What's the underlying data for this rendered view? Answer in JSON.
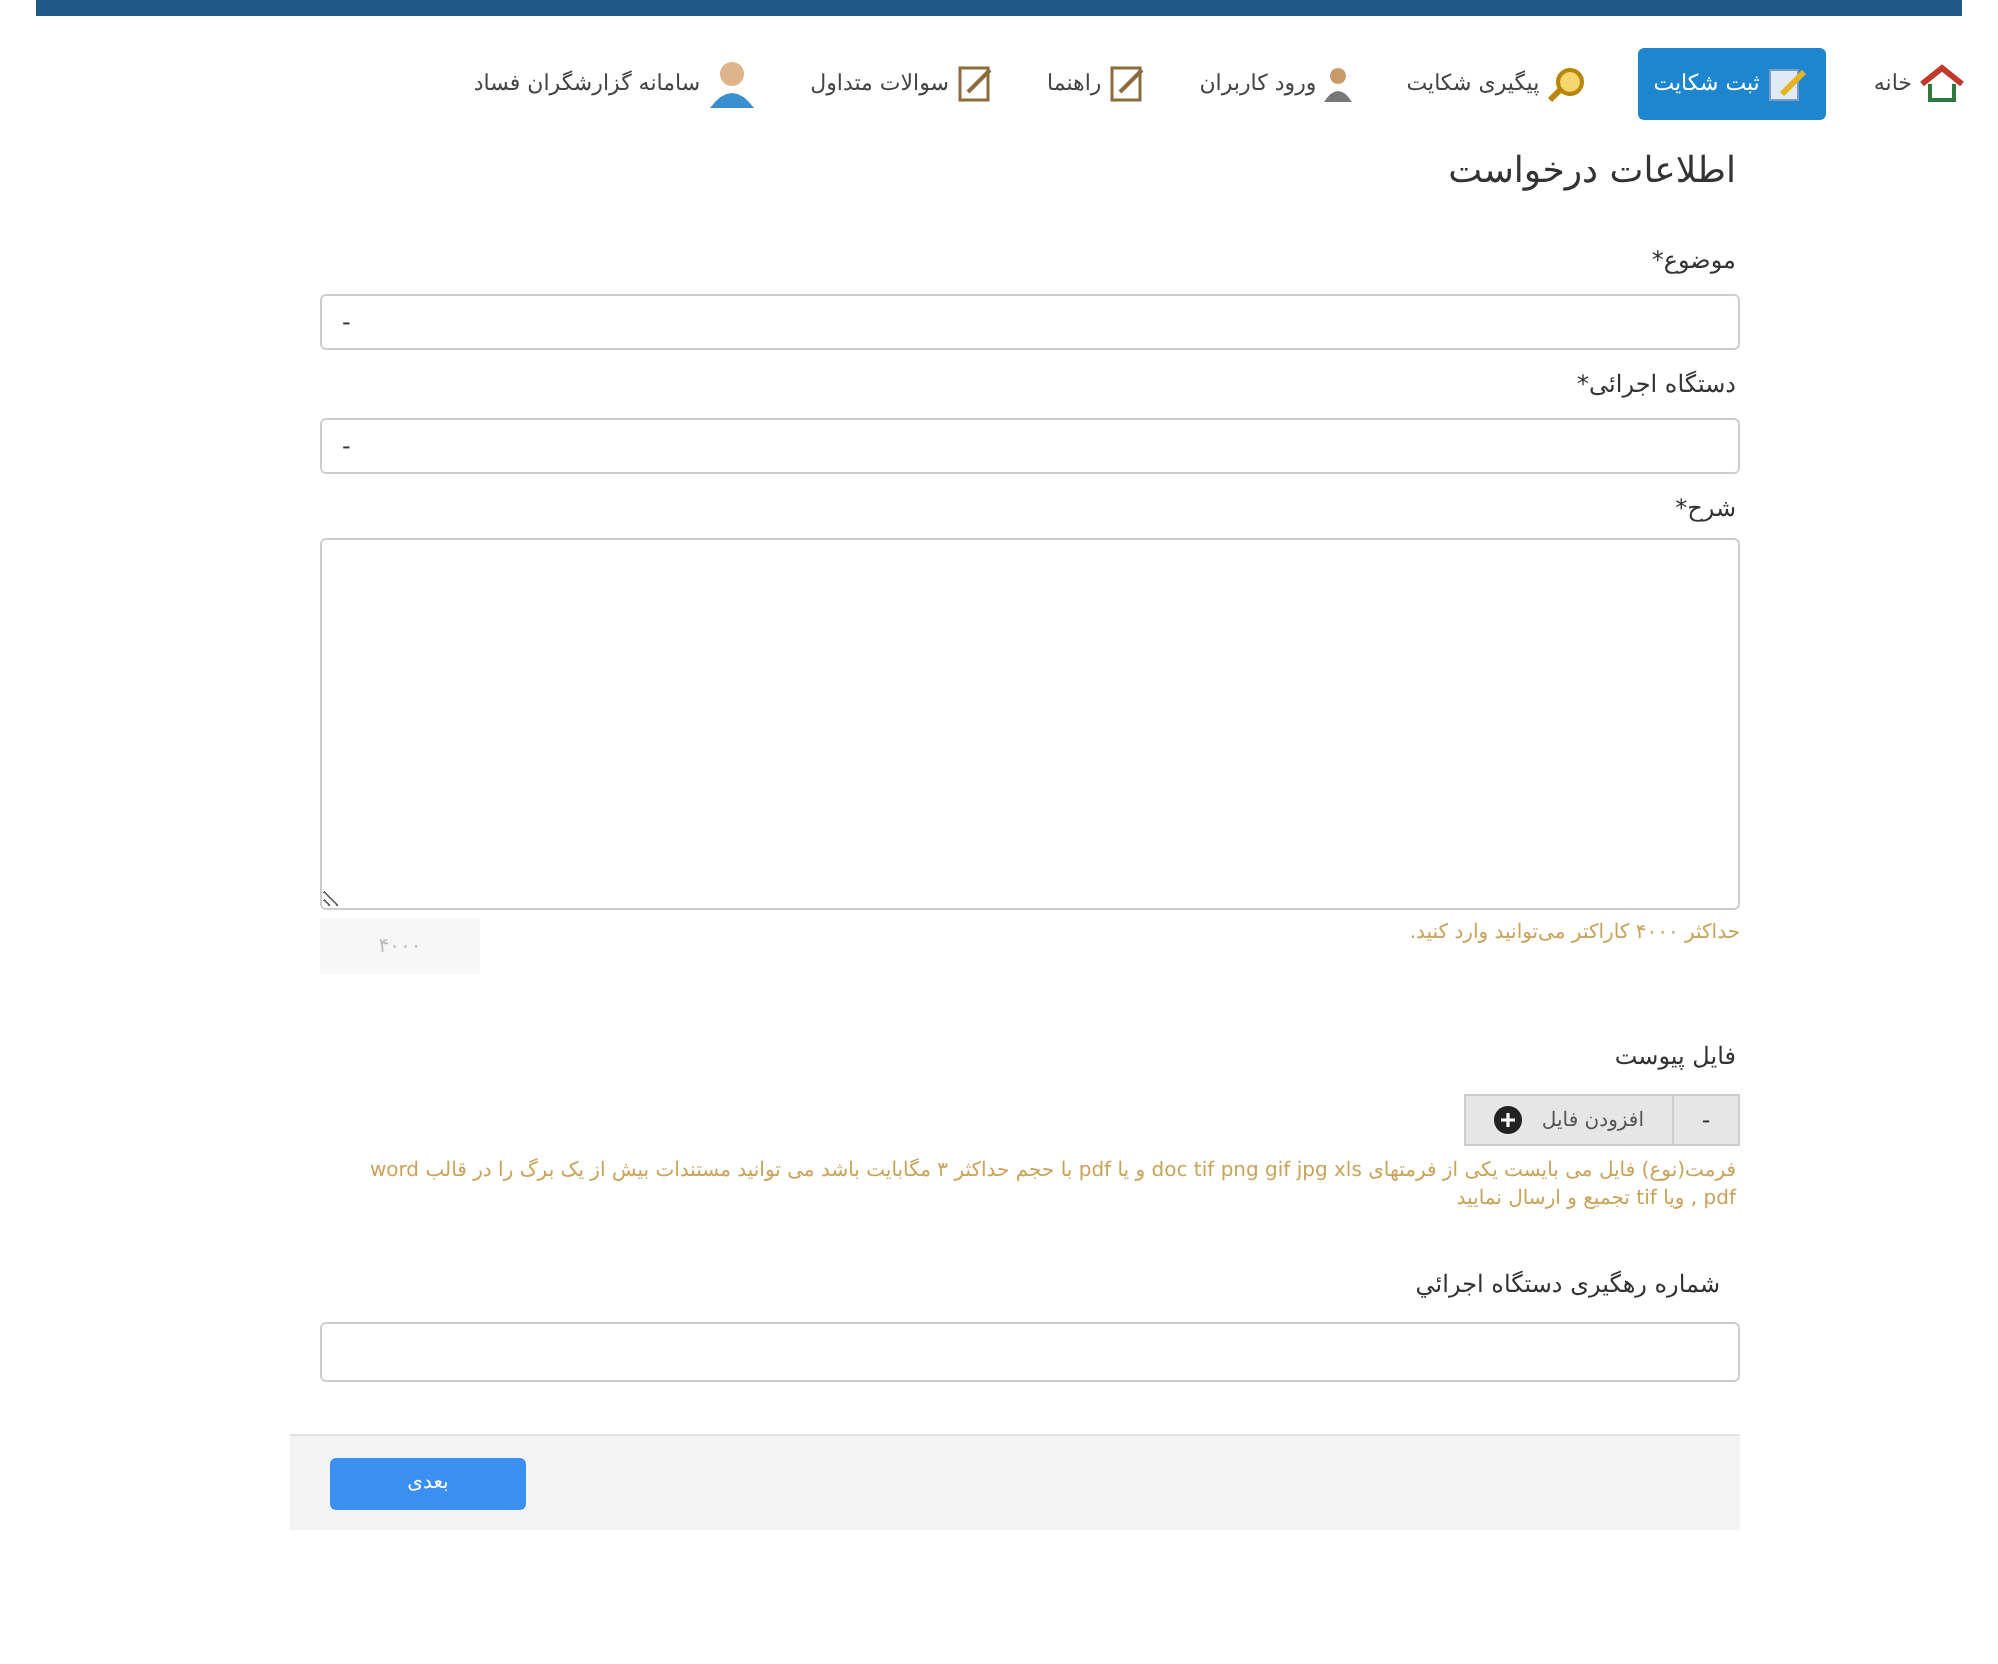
{
  "nav": [
    {
      "label": "خانه",
      "selected": false
    },
    {
      "label": "ثبت شکایت",
      "selected": true
    },
    {
      "label": "پیگیری شکایت",
      "selected": false
    },
    {
      "label": "ورود کاربران",
      "selected": false
    },
    {
      "label": "راهنما",
      "selected": false
    },
    {
      "label": "سوالات متداول",
      "selected": false
    },
    {
      "label": "سامانه گزارشگران فساد",
      "selected": false
    }
  ],
  "form": {
    "title": "اطلاعات درخواست",
    "subject": {
      "label": "موضوع",
      "required_mark": "*",
      "value": "-"
    },
    "agency": {
      "label": "دستگاه اجرائی",
      "required_mark": "*",
      "value": "-"
    },
    "description": {
      "label": "شرح",
      "required_mark": "*",
      "hint": "حداکثر ۴۰۰۰ کاراکتر می‌توانید وارد کنید.",
      "counter": "۴۰۰۰"
    },
    "attachment": {
      "label": "فایل پیوست",
      "remove": "-",
      "add": "افزودن فایل",
      "note": "فرمت(نوع) فایل می بایست یکی از فرمتهای doc tif png gif jpg xls و یا pdf با حجم حداکثر ۳ مگابایت باشد می توانید مستندات بیش از یک برگ را در قالب word , pdf ویا tif تجمیع و ارسال نمایید"
    },
    "tracking": {
      "label": "شماره رهگیری دستگاه اجرائي"
    },
    "next_button": "بعدی"
  }
}
